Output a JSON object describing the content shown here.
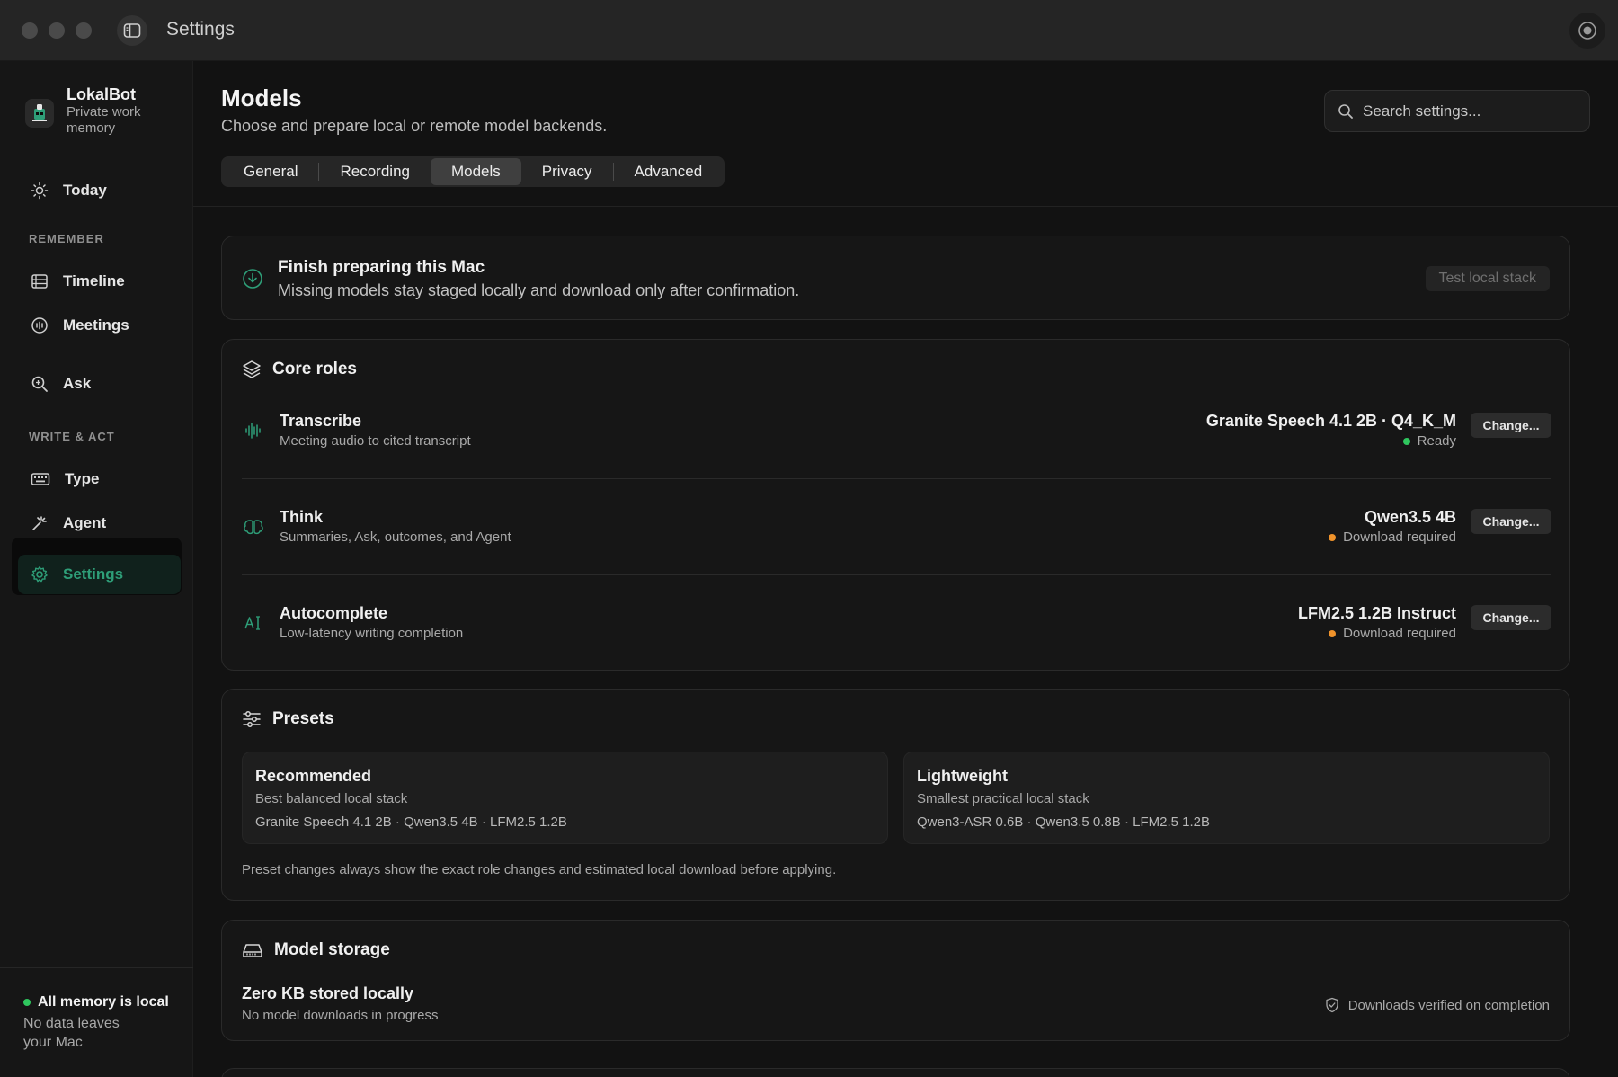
{
  "window": {
    "title": "Settings"
  },
  "sidebar": {
    "brand_name": "LokalBot",
    "brand_sub": "Private work memory",
    "items": {
      "today": "Today",
      "section_remember": "REMEMBER",
      "timeline": "Timeline",
      "meetings": "Meetings",
      "ask": "Ask",
      "section_write_act": "WRITE & ACT",
      "type": "Type",
      "agent": "Agent",
      "settings": "Settings"
    },
    "status": {
      "title": "All memory is local",
      "subtitle": "No data leaves your Mac"
    }
  },
  "header": {
    "title": "Models",
    "subtitle": "Choose and prepare local or remote model backends.",
    "search_placeholder": "Search settings..."
  },
  "tabs": [
    {
      "label": "General"
    },
    {
      "label": "Recording"
    },
    {
      "label": "Models",
      "selected": true
    },
    {
      "label": "Privacy"
    },
    {
      "label": "Advanced"
    }
  ],
  "banner": {
    "title": "Finish preparing this Mac",
    "subtitle": "Missing models stay staged locally and download only after confirmation.",
    "button": "Test local stack"
  },
  "core_roles": {
    "title": "Core roles",
    "change_label": "Change...",
    "roles": [
      {
        "name": "Transcribe",
        "desc": "Meeting audio to cited transcript",
        "model": "Granite Speech 4.1 2B · Q4_K_M",
        "status": "Ready",
        "status_color": "#2fc65e",
        "icon": "waveform-icon"
      },
      {
        "name": "Think",
        "desc": "Summaries, Ask, outcomes, and Agent",
        "model": "Qwen3.5 4B",
        "status": "Download required",
        "status_color": "#f0932b",
        "icon": "brain-icon"
      },
      {
        "name": "Autocomplete",
        "desc": "Low-latency writing completion",
        "model": "LFM2.5 1.2B Instruct",
        "status": "Download required",
        "status_color": "#f0932b",
        "icon": "text-cursor-icon"
      }
    ]
  },
  "presets": {
    "title": "Presets",
    "items": [
      {
        "name": "Recommended",
        "desc": "Best balanced local stack",
        "models": "Granite Speech 4.1 2B · Qwen3.5 4B · LFM2.5 1.2B"
      },
      {
        "name": "Lightweight",
        "desc": "Smallest practical local stack",
        "models": "Qwen3-ASR 0.6B · Qwen3.5 0.8B · LFM2.5 1.2B"
      }
    ],
    "note": "Preset changes always show the exact role changes and estimated local download before applying."
  },
  "storage": {
    "title": "Model storage",
    "stored": "Zero KB stored locally",
    "progress": "No model downloads in progress",
    "verified": "Downloads verified on completion"
  },
  "colors": {
    "accent": "#2e9e78",
    "ready": "#2fc65e",
    "warning": "#f0932b"
  }
}
